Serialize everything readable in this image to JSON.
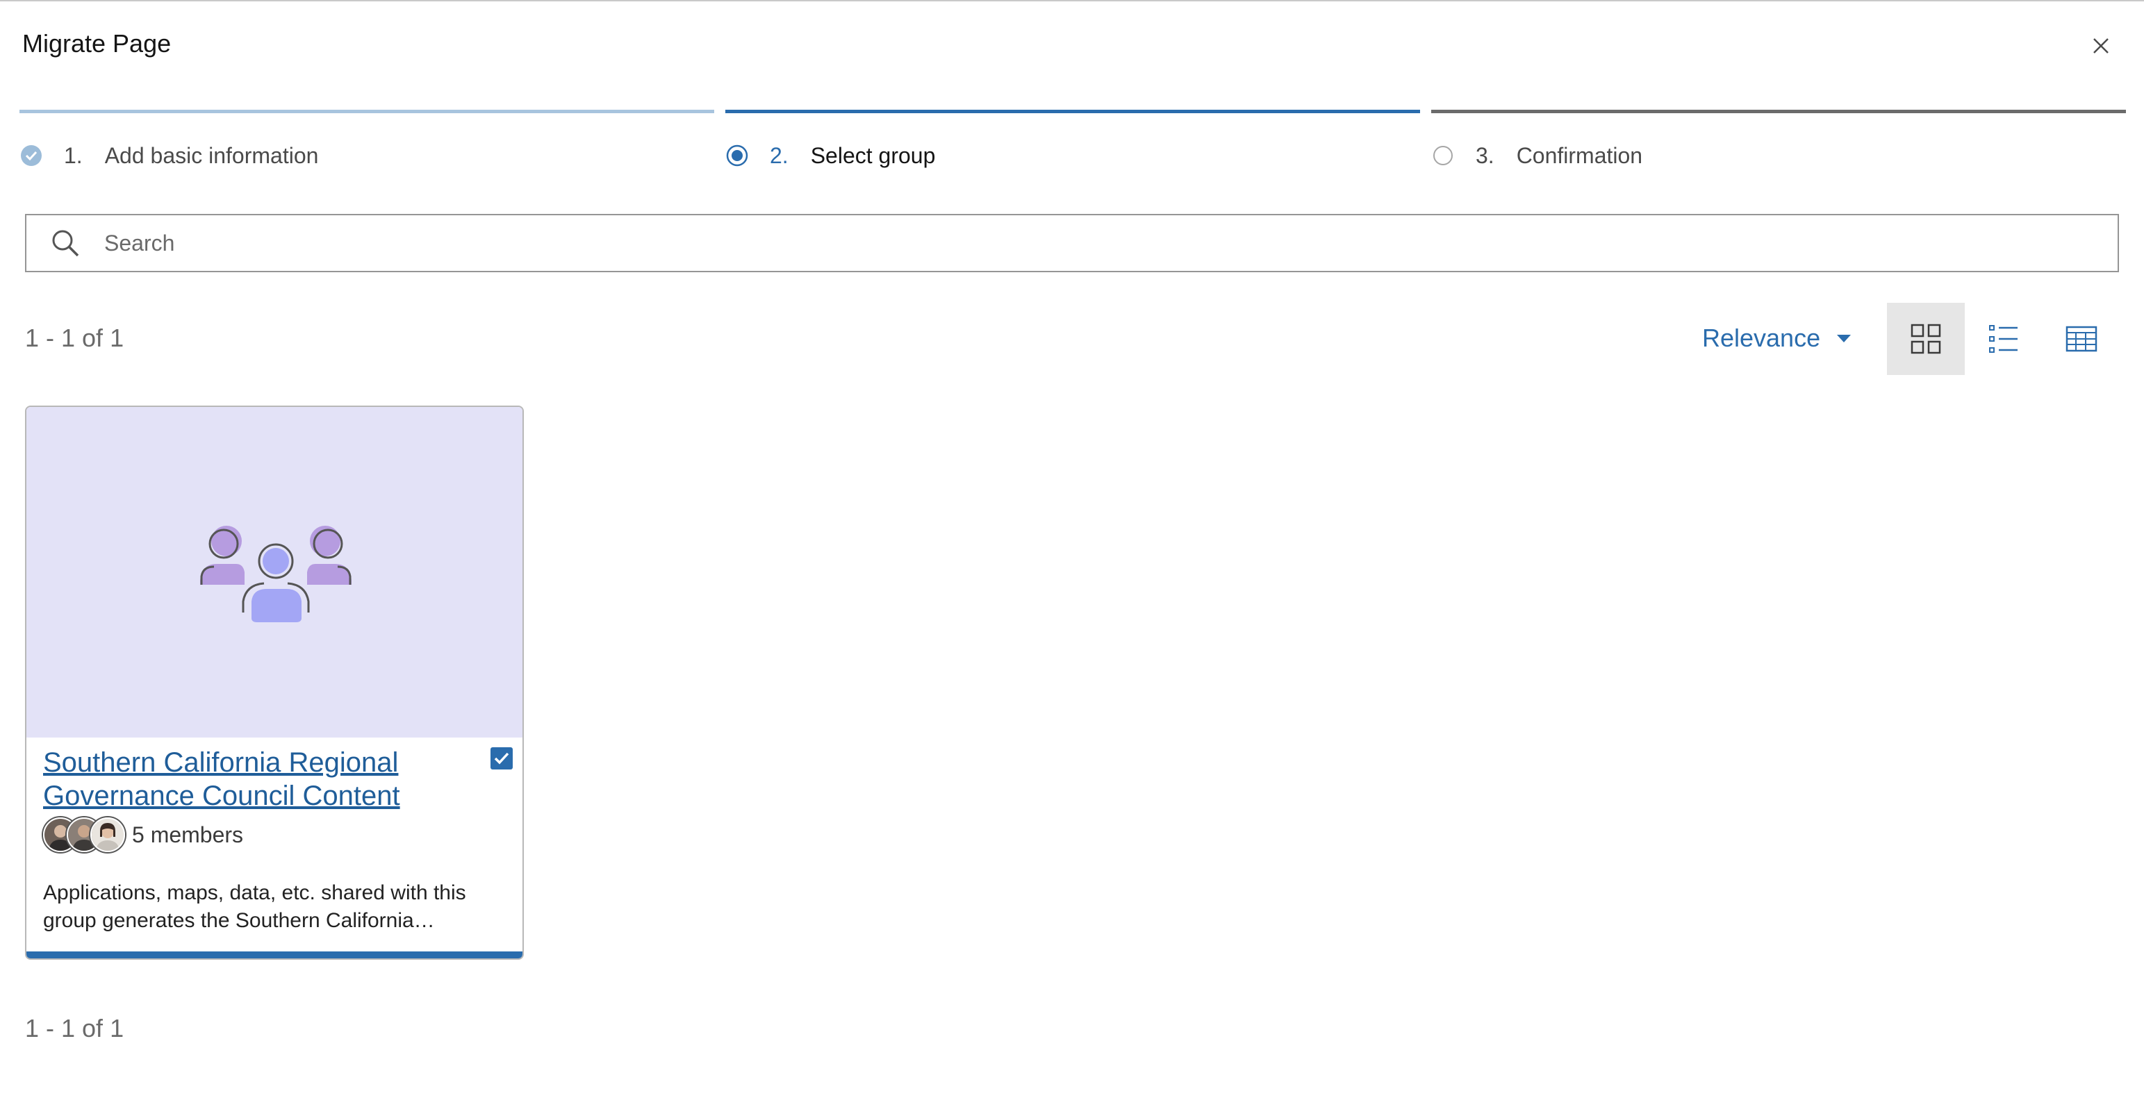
{
  "dialog": {
    "title": "Migrate Page"
  },
  "steps": [
    {
      "number": "1.",
      "label": "Add basic information",
      "state": "complete"
    },
    {
      "number": "2.",
      "label": "Select group",
      "state": "current"
    },
    {
      "number": "3.",
      "label": "Confirmation",
      "state": "upcoming"
    }
  ],
  "search": {
    "placeholder": "Search",
    "value": ""
  },
  "results": {
    "count_top": "1 - 1 of 1",
    "count_bottom": "1 - 1 of 1"
  },
  "sort": {
    "label": "Relevance"
  },
  "view_modes": [
    {
      "icon": "grid-view-icon",
      "selected": true
    },
    {
      "icon": "list-view-icon",
      "selected": false
    },
    {
      "icon": "table-view-icon",
      "selected": false
    }
  ],
  "cards": [
    {
      "title": "Southern California Regional Governance Council Content",
      "checked": true,
      "members": "5 members",
      "description": "Applications, maps, data, etc. shared with this group generates the Southern California…",
      "thumbnail_icon": "group-icon"
    }
  ],
  "colors": {
    "accent": "#2a6cad",
    "thumbnail_bg": "#e3e2f7",
    "link": "#1f5d99"
  }
}
